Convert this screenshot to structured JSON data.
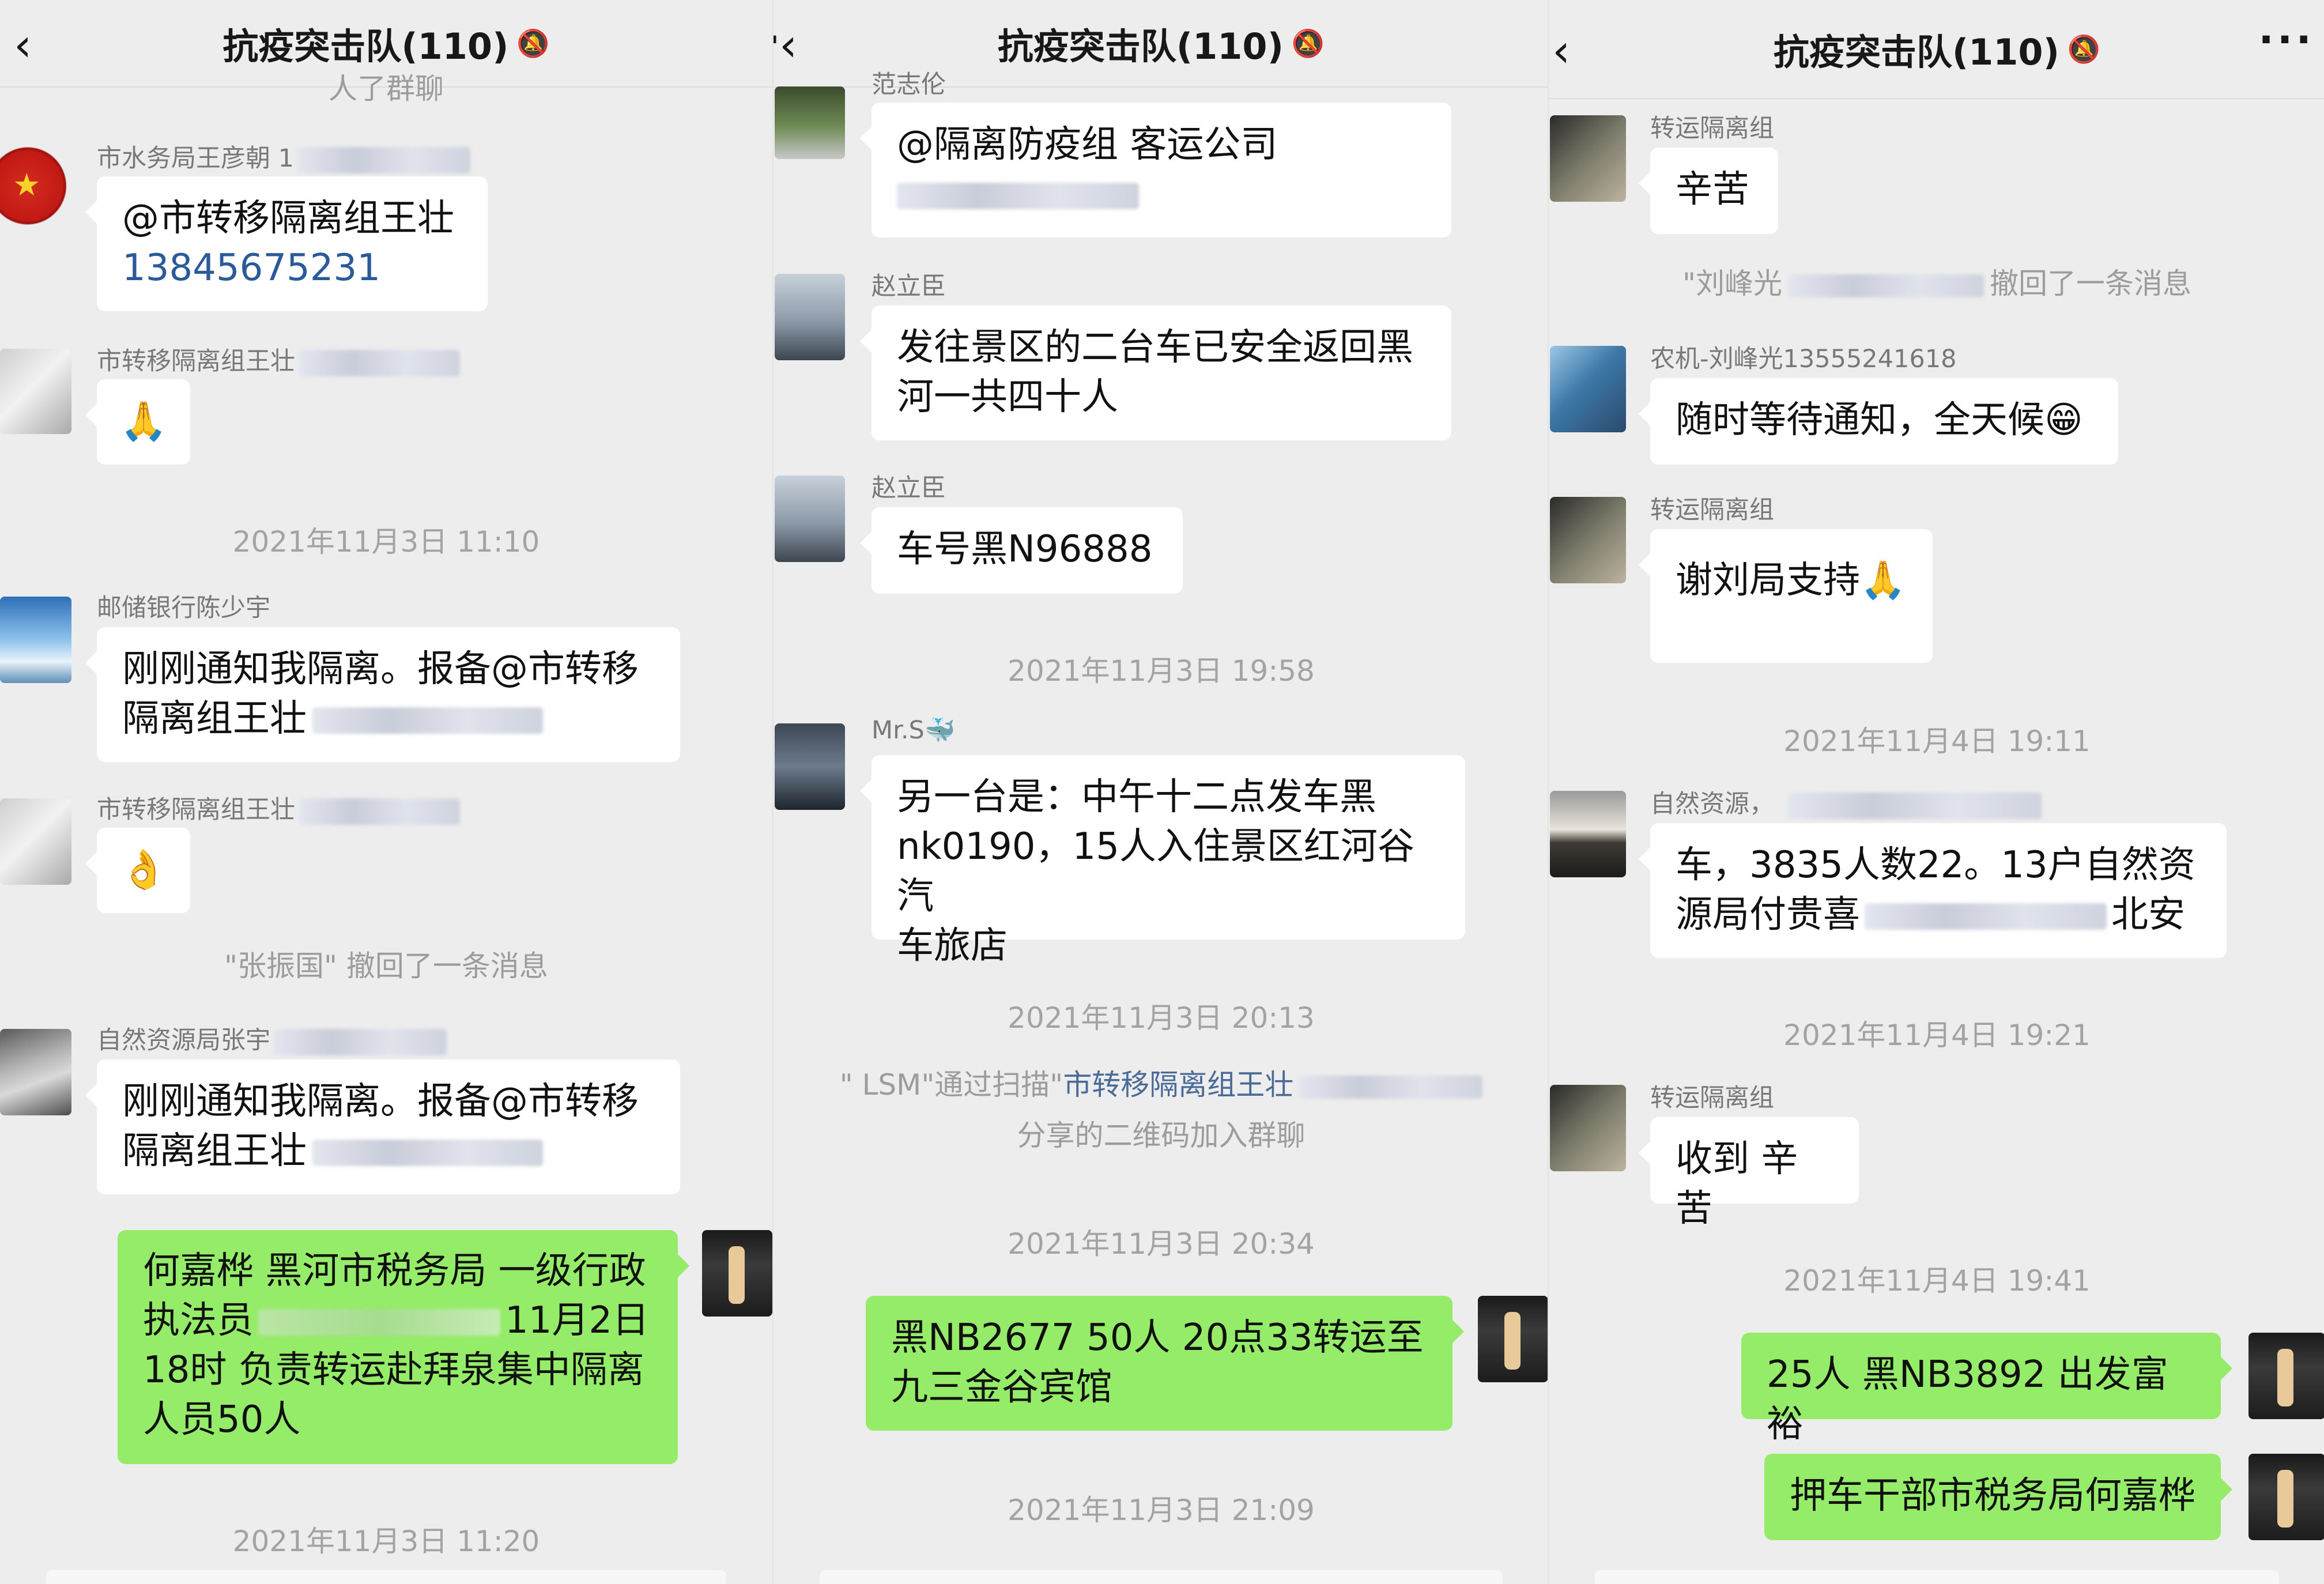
{
  "title": "抗疫突击队(110)",
  "panels": [
    {
      "top_fragment": "人了群聊",
      "messages": [
        {
          "sender": "市水务局王彦朝 1",
          "lines": [
            "@市转移隔离组王壮",
            "13845675231"
          ]
        },
        {
          "sender": "市转移隔离组王壮",
          "emoji": "🙏"
        },
        {
          "timestamp": "2021年11月3日 11:10"
        },
        {
          "sender": "邮储银行陈少宇",
          "lines": [
            "刚刚通知我隔离。报备@市转移",
            "隔离组王壮"
          ]
        },
        {
          "sender": "市转移隔离组王壮",
          "emoji": "👌"
        },
        {
          "system": "\"张振国\" 撤回了一条消息"
        },
        {
          "sender": "自然资源局张宇",
          "lines": [
            "刚刚通知我隔离。报备@市转移",
            "隔离组王壮"
          ]
        },
        {
          "self": true,
          "lines": [
            "何嘉桦 黑河市税务局 一级行政",
            "执法员",
            "11月2日",
            "18时 负责转运赴拜泉集中隔离",
            "人员50人"
          ]
        },
        {
          "timestamp": "2021年11月3日 11:20"
        }
      ]
    },
    {
      "top_fragment": "范志伦",
      "messages": [
        {
          "lines": [
            "@隔离防疫组 客运公司"
          ]
        },
        {
          "sender": "赵立臣",
          "lines": [
            "发往景区的二台车已安全返回黑",
            "河一共四十人"
          ]
        },
        {
          "sender": "赵立臣",
          "lines": [
            "车号黑N96888"
          ]
        },
        {
          "timestamp": "2021年11月3日 19:58"
        },
        {
          "sender": "Mr.S🐳",
          "lines": [
            "另一台是：中午十二点发车黑",
            "nk0190，15人入住景区红河谷汽",
            "车旅店"
          ]
        },
        {
          "timestamp": "2021年11月3日 20:13"
        },
        {
          "system_pre": "\" LSM\"通过扫描\"",
          "system_link": "市转移隔离组王壮",
          "system_post": "分享的二维码加入群聊"
        },
        {
          "timestamp": "2021年11月3日 20:34"
        },
        {
          "self": true,
          "lines": [
            "黑NB2677 50人 20点33转运至",
            "九三金谷宾馆"
          ]
        },
        {
          "timestamp": "2021年11月3日 21:09"
        }
      ]
    },
    {
      "messages": [
        {
          "sender": "转运隔离组",
          "lines": [
            "辛苦"
          ]
        },
        {
          "system_pre": "\"刘峰光",
          "system_post": "撤回了一条消息"
        },
        {
          "sender": "农机-刘峰光13555241618",
          "lines": [
            "随时等待通知，全天候😁"
          ]
        },
        {
          "sender": "转运隔离组",
          "lines": [
            "谢刘局支持🙏"
          ]
        },
        {
          "timestamp": "2021年11月4日 19:11"
        },
        {
          "sender": "自然资源，",
          "lines": [
            "车，3835人数22。13户自然资",
            "源局付贵喜",
            "北安"
          ]
        },
        {
          "timestamp": "2021年11月4日 19:21"
        },
        {
          "sender": "转运隔离组",
          "lines": [
            "收到 辛苦"
          ]
        },
        {
          "timestamp": "2021年11月4日 19:41"
        },
        {
          "self": true,
          "lines": [
            "25人 黑NB3892 出发富裕"
          ]
        },
        {
          "self": true,
          "lines": [
            "押车干部市税务局何嘉桦"
          ]
        }
      ]
    }
  ],
  "icons": {
    "back": "back-arrow-icon",
    "more": "more-dots-icon",
    "mute": "mute-bell-icon"
  },
  "colors": {
    "self_bubble": "#95ec69",
    "other_bubble": "#ffffff",
    "background": "#ededed",
    "link": "#2b5a9b"
  }
}
